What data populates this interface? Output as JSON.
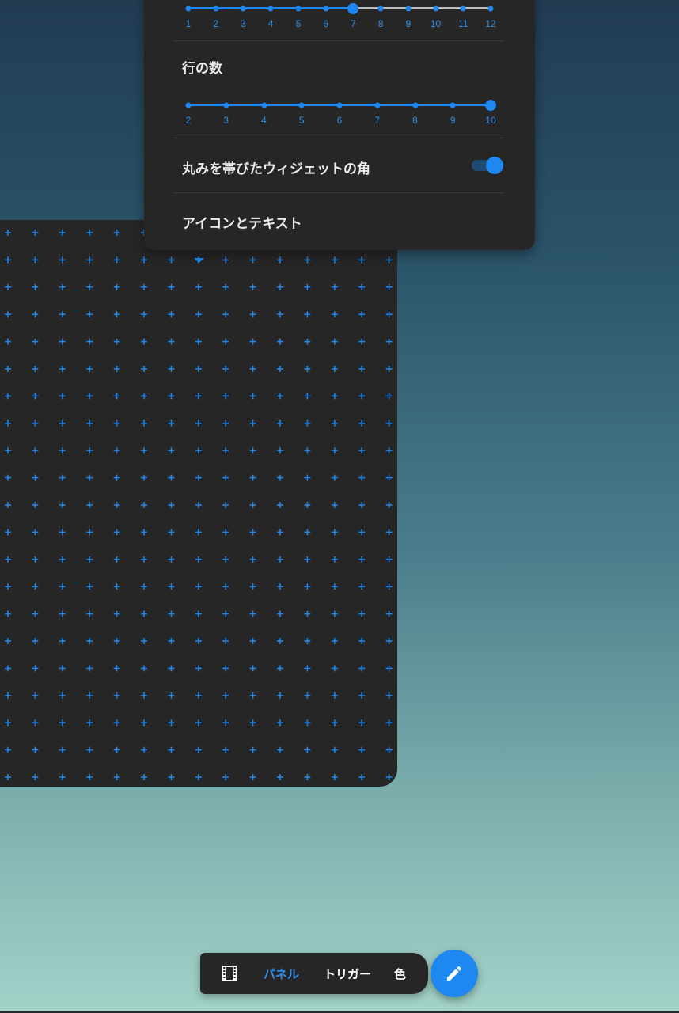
{
  "settings": {
    "column_slider": {
      "ticks": [
        "1",
        "2",
        "3",
        "4",
        "5",
        "6",
        "7",
        "8",
        "9",
        "10",
        "11",
        "12"
      ],
      "selected": 7
    },
    "rows": {
      "title": "行の数",
      "ticks": [
        "2",
        "3",
        "4",
        "5",
        "6",
        "7",
        "8",
        "9",
        "10"
      ],
      "selected": 10
    },
    "rounded_corners": {
      "label": "丸みを帯びたウィジェットの角",
      "enabled": true
    },
    "icons_text": {
      "label": "アイコンとテキスト"
    }
  },
  "toolbar": {
    "items": [
      "パネル",
      "トリガー",
      "色"
    ],
    "active": "パネル",
    "film_icon": "film-icon",
    "fab_icon": "pencil-icon"
  },
  "colors": {
    "accent": "#1e88f0",
    "panel": "#262626"
  }
}
